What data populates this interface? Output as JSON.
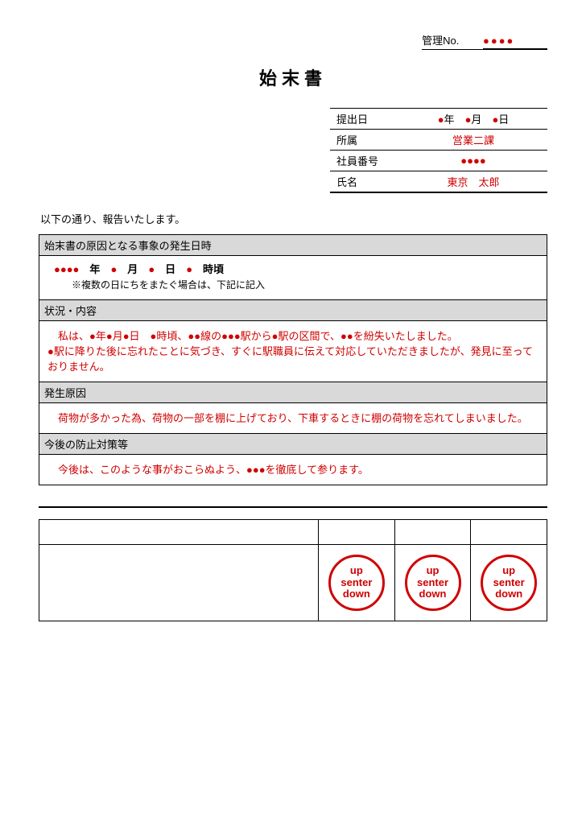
{
  "kanri": {
    "label": "管理No.",
    "value": "●●●●"
  },
  "title": "始末書",
  "header": [
    {
      "label": "提出日",
      "value_html": "●<span class='normaltxt'>年　</span>●<span class='normaltxt'>月　</span>●<span class='normaltxt'>日</span>"
    },
    {
      "label": "所属",
      "value": "営業二課"
    },
    {
      "label": "社員番号",
      "value": "●●●●"
    },
    {
      "label": "氏名",
      "value": "東京　太郎"
    }
  ],
  "intro": "以下の通り、報告いたします。",
  "sections": {
    "datetime": {
      "head": "始末書の原因となる事象の発生日時",
      "line": "●●●●　<span class='normaltxt'>年</span>　●　<span class='normaltxt'>月</span>　●　<span class='normaltxt'>日</span>　●　<span class='normaltxt'>時頃</span>",
      "note": "※複数の日にちをまたぐ場合は、下記に記入"
    },
    "situation": {
      "head": "状況・内容",
      "body": "　私は、●年●月●日　●時頃、●●線の●●●駅から●駅の区間で、●●を紛失いたしました。<br>●駅に降りた後に忘れたことに気づき、すぐに駅職員に伝えて対応していただきましたが、発見に至っておりません。"
    },
    "cause": {
      "head": "発生原因",
      "body": "　荷物が多かった為、荷物の一部を棚に上げており、下車するときに棚の荷物を忘れてしまいました。"
    },
    "future": {
      "head": "今後の防止対策等",
      "body": "　今後は、このような事がおこらぬよう、●●●を徹底して参ります。"
    }
  },
  "stamp": {
    "lines": [
      "up",
      "senter",
      "down"
    ]
  }
}
